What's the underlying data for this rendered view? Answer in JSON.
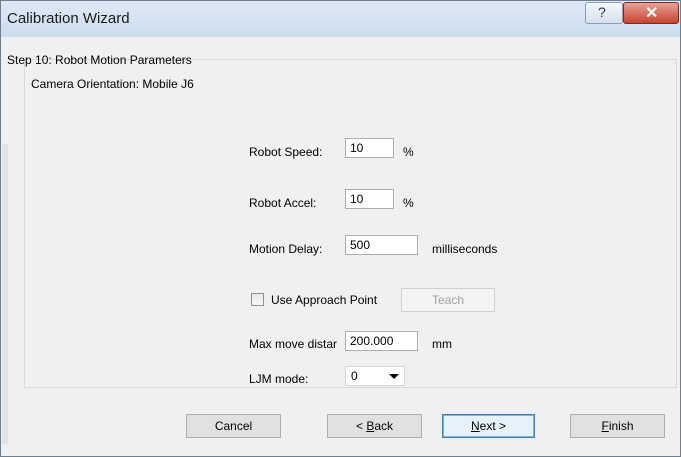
{
  "window": {
    "title": "Calibration Wizard",
    "help_glyph": "?",
    "close_glyph": "✕"
  },
  "step": {
    "title": "Step 10: Robot Motion Parameters",
    "camera_orientation": "Camera Orientation: Mobile J6"
  },
  "fields": {
    "robot_speed_label": "Robot Speed:",
    "robot_speed_value": "10",
    "robot_speed_unit": "%",
    "robot_accel_label": "Robot Accel:",
    "robot_accel_value": "10",
    "robot_accel_unit": "%",
    "motion_delay_label": "Motion Delay:",
    "motion_delay_value": "500",
    "motion_delay_unit": "milliseconds",
    "approach_label": "Use Approach Point",
    "approach_checked": false,
    "teach_label": "Teach",
    "max_move_label": "Max move distar",
    "max_move_value": "200.000",
    "max_move_unit": "mm",
    "ljm_label": "LJM mode:",
    "ljm_value": "0"
  },
  "buttons": {
    "cancel_label": "Cancel",
    "back_prefix": "< ",
    "back_accel": "B",
    "back_rest": "ack",
    "next_accel": "N",
    "next_rest": "ext >",
    "finish_accel": "F",
    "finish_rest": "inish"
  }
}
